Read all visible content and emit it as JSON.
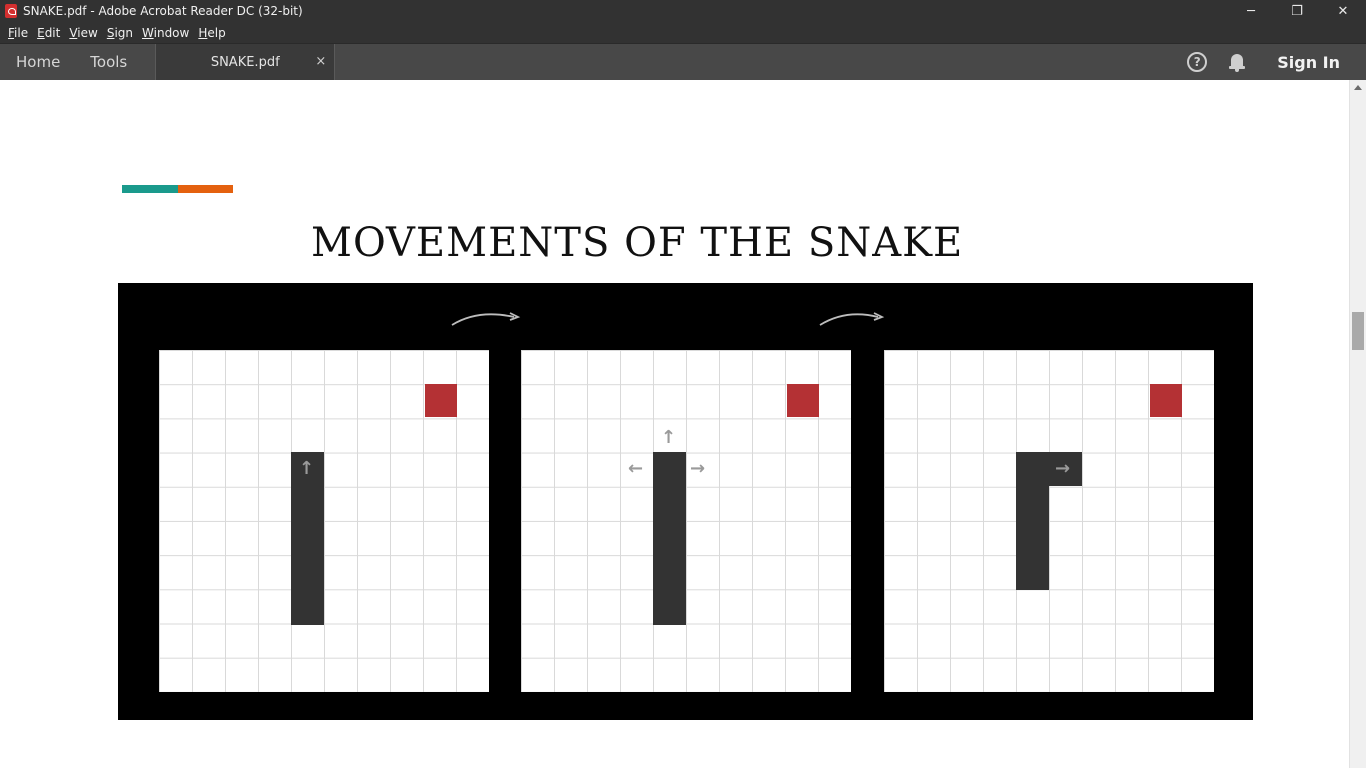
{
  "window": {
    "title": "SNAKE.pdf - Adobe Acrobat Reader DC (32-bit)",
    "controls": {
      "minimize": "─",
      "restore": "❐",
      "close": "✕"
    }
  },
  "menu": {
    "items": [
      {
        "key": "F",
        "rest": "ile"
      },
      {
        "key": "E",
        "rest": "dit"
      },
      {
        "key": "V",
        "rest": "iew"
      },
      {
        "key": "S",
        "rest": "ign"
      },
      {
        "key": "W",
        "rest": "indow"
      },
      {
        "key": "H",
        "rest": "elp"
      }
    ]
  },
  "tabs": {
    "home": "Home",
    "tools": "Tools",
    "document": "SNAKE.pdf",
    "document_close": "×",
    "help_glyph": "?",
    "sign_in": "Sign In"
  },
  "document": {
    "heading": "MOVEMENTS OF THE SNAKE",
    "accent_colors": {
      "teal": "#1a9a8c",
      "orange": "#e4610f"
    },
    "figure": {
      "panel_count": 3,
      "food_color": "#b43134",
      "snake_color": "#333333",
      "panels": [
        {
          "arrows": {
            "up": "↑"
          }
        },
        {
          "arrows": {
            "up": "↑",
            "left": "←",
            "right": "→"
          }
        },
        {
          "arrows": {
            "right": "→"
          }
        }
      ]
    }
  },
  "scrollbar": {
    "position_fraction": 0.34
  }
}
